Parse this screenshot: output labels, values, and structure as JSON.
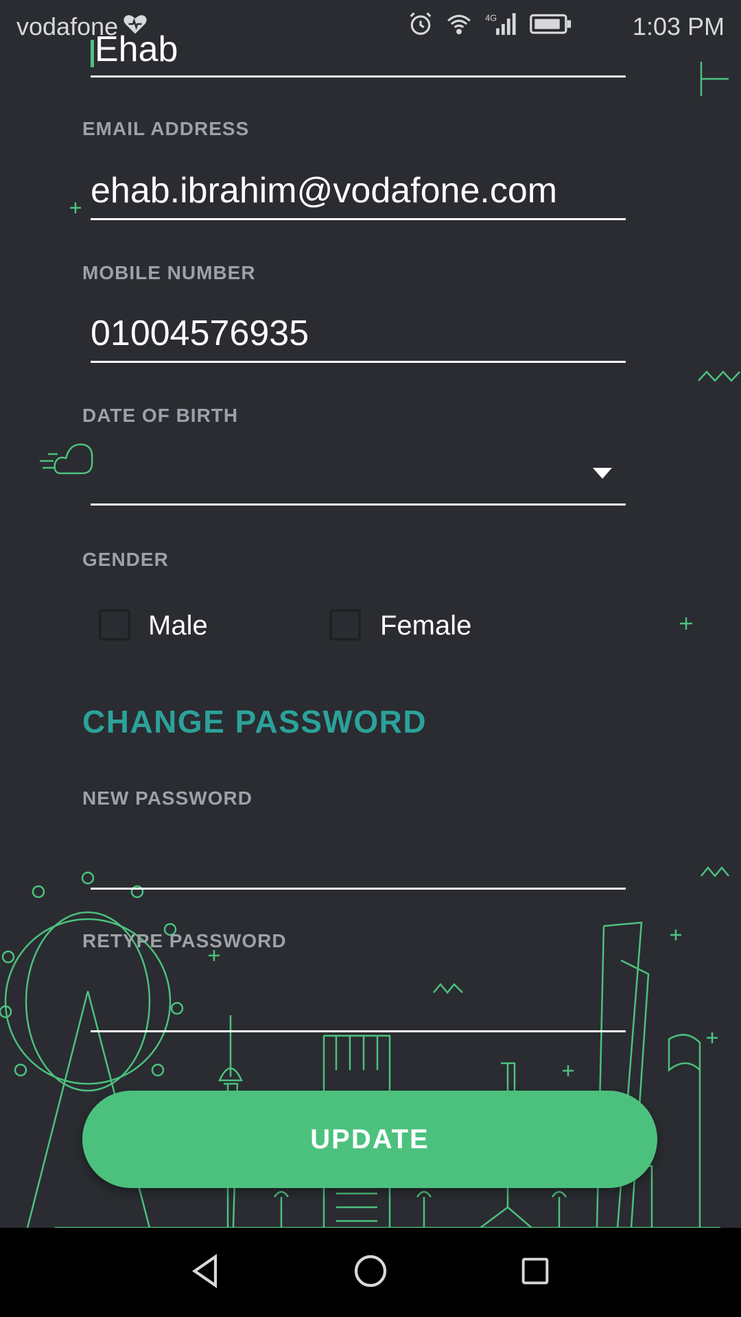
{
  "status_bar": {
    "carrier": "vodafone",
    "time": "1:03 PM",
    "network": "4G"
  },
  "form": {
    "name_value": "Ehab",
    "email": {
      "label": "EMAIL ADDRESS",
      "value": "ehab.ibrahim@vodafone.com"
    },
    "mobile": {
      "label": "MOBILE NUMBER",
      "value": "01004576935"
    },
    "dob": {
      "label": "DATE OF BIRTH",
      "value": ""
    },
    "gender": {
      "label": "GENDER",
      "options": [
        "Male",
        "Female"
      ]
    },
    "change_password_title": "CHANGE PASSWORD",
    "new_password": {
      "label": "NEW PASSWORD",
      "value": ""
    },
    "retype_password": {
      "label": "RETYPE PASSWORD",
      "value": ""
    },
    "update_label": "UPDATE"
  },
  "colors": {
    "background": "#2a2c31",
    "accent_green": "#4cc17e",
    "section_teal": "#2ba29a",
    "label_grey": "#9ea1a7"
  }
}
